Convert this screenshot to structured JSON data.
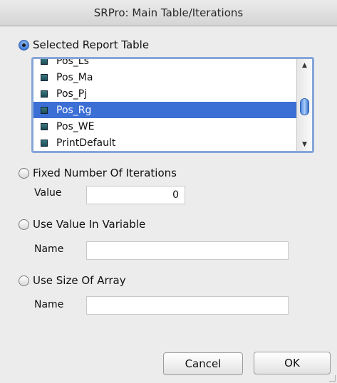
{
  "window": {
    "title": "SRPro: Main Table/Iterations"
  },
  "options": {
    "selected_report_table": "Selected Report Table",
    "fixed_number": "Fixed Number Of Iterations",
    "use_value_in_variable": "Use Value In Variable",
    "use_size_of_array": "Use Size Of Array",
    "selected": "selected_report_table"
  },
  "table_list": {
    "items": [
      "Pos_Ls",
      "Pos_Ma",
      "Pos_Pj",
      "Pos_Rg",
      "Pos_WE",
      "PrintDefault"
    ],
    "selected_item": "Pos_Rg",
    "scroll_position": 0.5
  },
  "fixed_number_field": {
    "label": "Value",
    "value": "0"
  },
  "variable_field": {
    "label": "Name",
    "value": ""
  },
  "array_field": {
    "label": "Name",
    "value": ""
  },
  "buttons": {
    "cancel": "Cancel",
    "ok": "OK"
  }
}
